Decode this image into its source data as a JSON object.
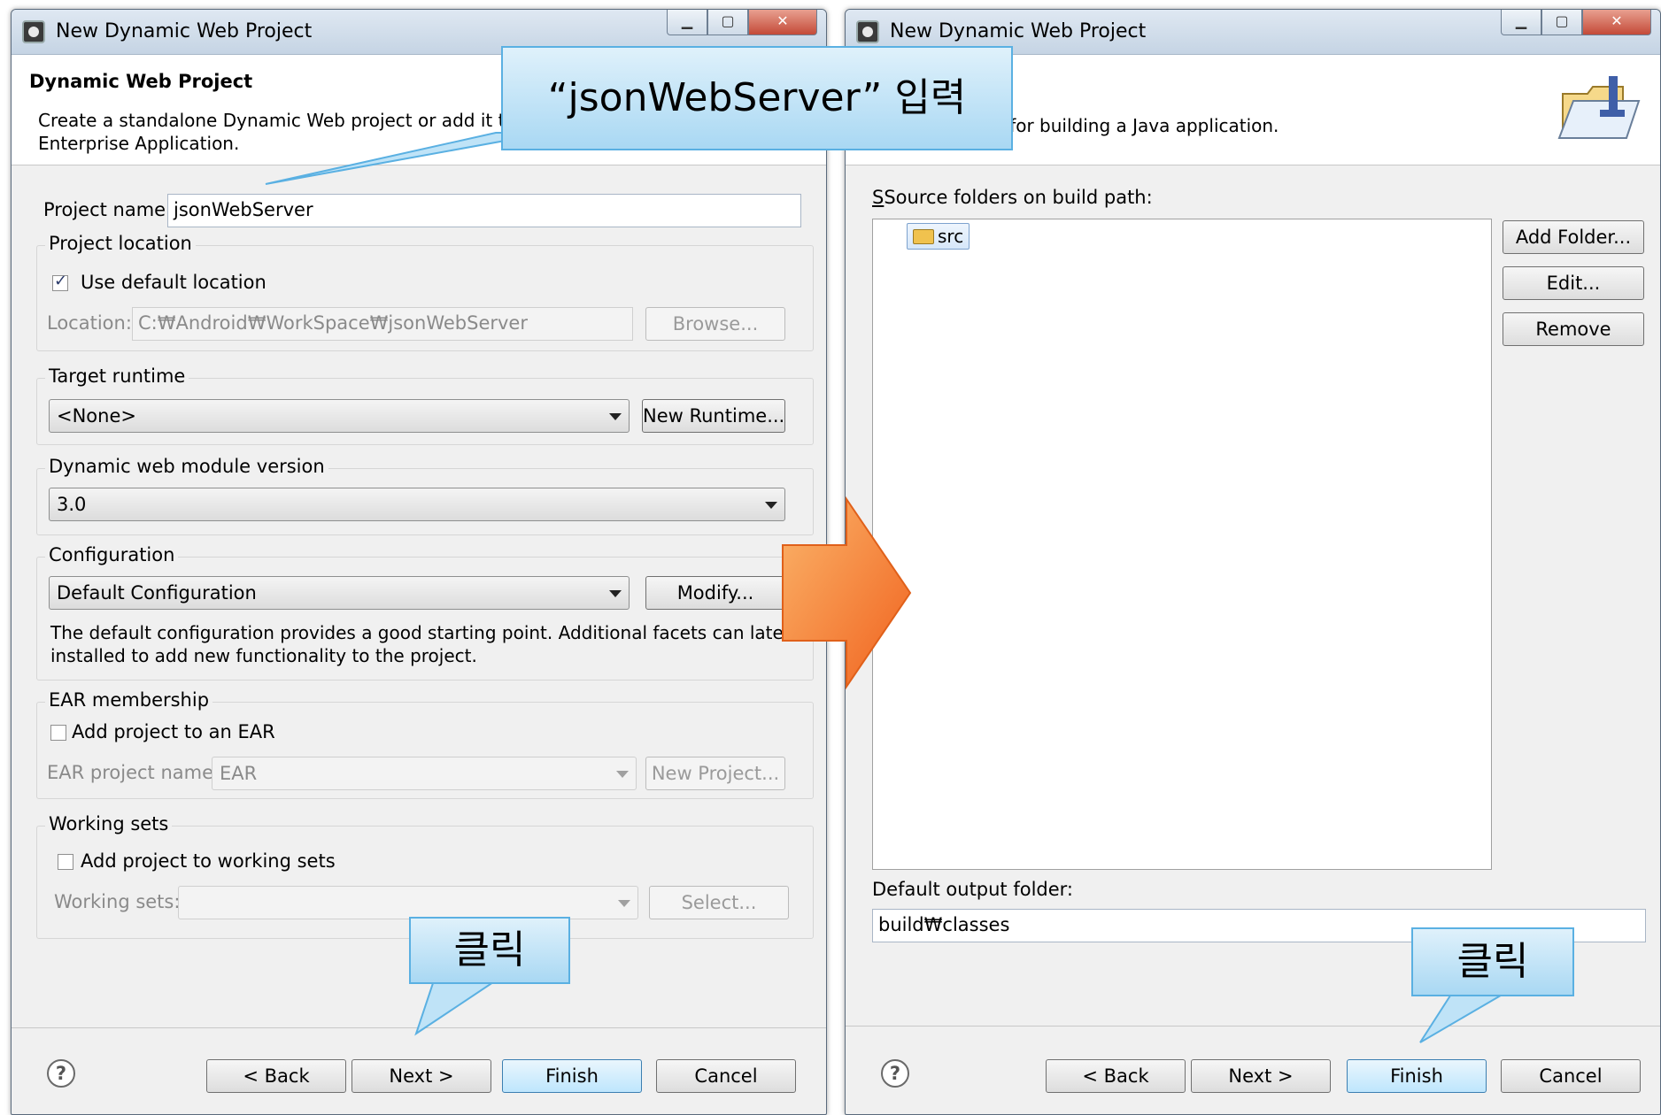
{
  "left_dialog": {
    "window_title": "New Dynamic Web Project",
    "header_title": "Dynamic Web Project",
    "header_desc_line1": "Create a standalone Dynamic Web project or add it t",
    "header_desc_line2": "Enterprise Application.",
    "project_name_label": "Project name:",
    "project_name_value": "jsonWebServer",
    "project_location": {
      "group_label": "Project location",
      "use_default_label": "Use default location",
      "use_default_checked": true,
      "location_label": "Location:",
      "location_value": "C:₩Android₩WorkSpace₩jsonWebServer",
      "browse_label": "Browse..."
    },
    "target_runtime": {
      "group_label": "Target runtime",
      "selected": "<None>",
      "new_runtime_label": "New Runtime..."
    },
    "module_version": {
      "group_label": "Dynamic web module version",
      "selected": "3.0"
    },
    "configuration": {
      "group_label": "Configuration",
      "selected": "Default Configuration",
      "modify_label": "Modify...",
      "desc_line1": "The default configuration provides a good starting point. Additional facets can later be",
      "desc_line2": "installed to add new functionality to the project."
    },
    "ear_membership": {
      "group_label": "EAR membership",
      "add_label": "Add project to an EAR",
      "add_checked": false,
      "ear_name_label": "EAR project name:",
      "ear_name_value": "EAR",
      "new_project_label": "New Project..."
    },
    "working_sets": {
      "group_label": "Working sets",
      "add_label": "Add project to working sets",
      "add_checked": false,
      "sets_label": "Working sets:",
      "select_label": "Select..."
    },
    "buttons": {
      "back": "< Back",
      "next": "Next >",
      "finish": "Finish",
      "cancel": "Cancel"
    }
  },
  "right_dialog": {
    "window_title": "New Dynamic Web Project",
    "header_desc": "ct for building a Java application.",
    "source_folders_label": "Source folders on build path:",
    "source_items": [
      "src"
    ],
    "add_folder_label": "Add Folder...",
    "edit_label": "Edit...",
    "remove_label": "Remove",
    "output_folder_label": "Default output folder:",
    "output_folder_value": "build₩classes",
    "buttons": {
      "back": "< Back",
      "next": "Next >",
      "finish": "Finish",
      "cancel": "Cancel"
    }
  },
  "annotations": {
    "input_callout": "“jsonWebServer” 입력",
    "click_callout_left": "클릭",
    "click_callout_right": "클릭"
  },
  "colors": {
    "callout_fill": "#a9d8f3",
    "callout_border": "#5ab0e2",
    "arrow_orange": "#f47a2a",
    "default_button": "#bee6fd"
  }
}
